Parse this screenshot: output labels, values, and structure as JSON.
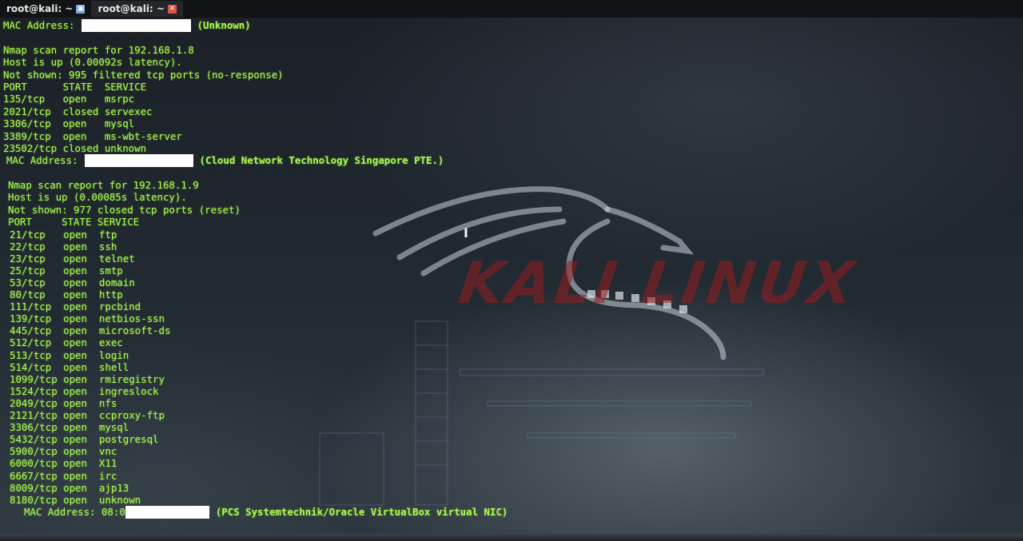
{
  "tabs": [
    {
      "label": "root@kali: ~",
      "icon": "terminal-icon",
      "active": false
    },
    {
      "label": "root@kali: ~",
      "icon": "close-icon",
      "active": true
    }
  ],
  "backdrop": {
    "wordmark": "KALI LINUX",
    "wordmark_color": "#961e20"
  },
  "terminal": {
    "text_color": "#a8f84d",
    "first_mac": {
      "prefix": "MAC Address:",
      "vendor": "(Unknown)"
    },
    "host1": {
      "report": "Nmap scan report for 192.168.1.8",
      "status": "Host is up (0.00092s latency).",
      "not_shown": "Not shown: 995 filtered tcp ports (no-response)",
      "header": "PORT      STATE  SERVICE",
      "ports": [
        "135/tcp   open   msrpc",
        "2021/tcp  closed servexec",
        "3306/tcp  open   mysql",
        "3389/tcp  open   ms-wbt-server",
        "23502/tcp closed unknown"
      ],
      "mac": {
        "prefix": "MAC Address:",
        "vendor": "(Cloud Network Technology Singapore PTE.)"
      }
    },
    "host2": {
      "report": "Nmap scan report for 192.168.1.9",
      "status": "Host is up (0.00085s latency).",
      "not_shown": "Not shown: 977 closed tcp ports (reset)",
      "header": "PORT     STATE SERVICE",
      "ports": [
        "21/tcp   open  ftp",
        "22/tcp   open  ssh",
        "23/tcp   open  telnet",
        "25/tcp   open  smtp",
        "53/tcp   open  domain",
        "80/tcp   open  http",
        "111/tcp  open  rpcbind",
        "139/tcp  open  netbios-ssn",
        "445/tcp  open  microsoft-ds",
        "512/tcp  open  exec",
        "513/tcp  open  login",
        "514/tcp  open  shell",
        "1099/tcp open  rmiregistry",
        "1524/tcp open  ingreslock",
        "2049/tcp open  nfs",
        "2121/tcp open  ccproxy-ftp",
        "3306/tcp open  mysql",
        "5432/tcp open  postgresql",
        "5900/tcp open  vnc",
        "6000/tcp open  X11",
        "6667/tcp open  irc",
        "8009/tcp open  ajp13",
        "8180/tcp open  unknown"
      ],
      "mac": {
        "prefix": "MAC Address: 08:0",
        "vendor": "(PCS Systemtechnik/Oracle VirtualBox virtual NIC)"
      }
    }
  }
}
